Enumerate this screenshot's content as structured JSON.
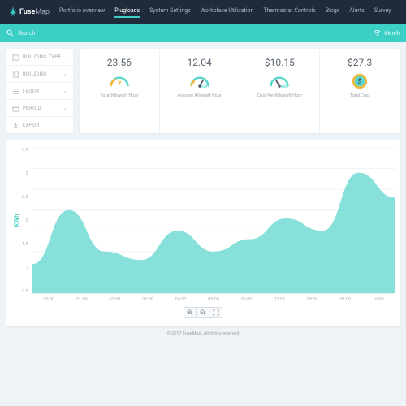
{
  "brand": {
    "name_a": "Fuse",
    "name_b": "Map"
  },
  "nav": {
    "items": [
      "Portfolio overview",
      "Plugloads",
      "System Settings",
      "Workplace Utilization",
      "Thermostat Controls",
      "Blogs",
      "Alerts",
      "Survey"
    ],
    "active": 1
  },
  "search": {
    "placeholder": "Search"
  },
  "speed": {
    "value": "9 km/h"
  },
  "filters": {
    "items": [
      {
        "label": "BUILDING TYPE",
        "chev": true
      },
      {
        "label": "BUILDING",
        "chev": true
      },
      {
        "label": "FLOOR",
        "chev": true
      },
      {
        "label": "PERIOD",
        "chev": true
      },
      {
        "label": "EXPORT",
        "chev": false
      }
    ]
  },
  "stats": [
    {
      "value": "23.56",
      "label": "Total Kilowatt Hour"
    },
    {
      "value": "12.04",
      "label": "Avarage Kilowatt Hour"
    },
    {
      "value": "$10.15",
      "label": "Cost Per Kilowatt Hour"
    },
    {
      "value": "$27.3",
      "label": "Total Cost"
    }
  ],
  "chart_data": {
    "type": "area",
    "ylabel": "KWh",
    "ylim": [
      0,
      3.5
    ],
    "yticks": [
      "3.5",
      "3",
      "2.5",
      "2",
      "1.5",
      "1",
      "0.5"
    ],
    "x": [
      "00:00",
      "01:00",
      "02:00",
      "03:00",
      "04:00",
      "05:00",
      "06:00",
      "07:00",
      "08:00",
      "09:00",
      "10:00"
    ],
    "values": [
      0.7,
      2.0,
      1.0,
      0.8,
      1.5,
      1.0,
      1.3,
      1.8,
      1.5,
      2.9,
      2.3
    ]
  },
  "footer": "© 2017 FuseMap. All rights reserved"
}
